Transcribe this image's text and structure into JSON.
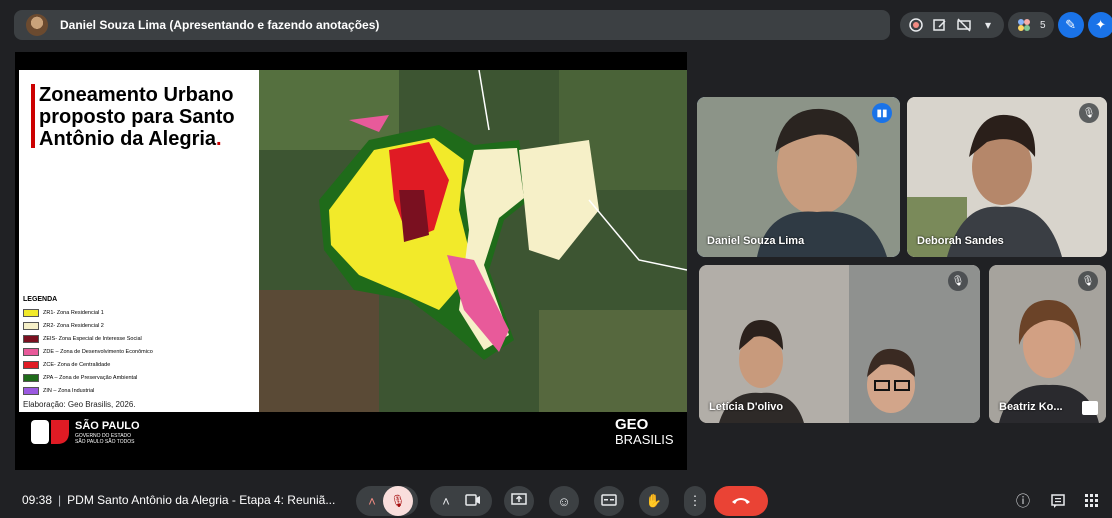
{
  "presenting": {
    "label": "Daniel Souza Lima (Apresentando e fazendo anotações)",
    "participant_count": "5"
  },
  "slide": {
    "title": "Zoneamento Urbano proposto para Santo Antônio da Alegria",
    "title_dot": ".",
    "legend_title": "LEGENDA",
    "legend": [
      {
        "label": "ZR1- Zona Residencial 1",
        "color": "#f2ea2a"
      },
      {
        "label": "ZR2- Zona Residencial 2",
        "color": "#f6f0c8"
      },
      {
        "label": "ZEIS- Zona Especial de Interesse Social",
        "color": "#7a1020"
      },
      {
        "label": "ZDE – Zona de Desenvolvimento Econômico",
        "color": "#e85a9a"
      },
      {
        "label": "ZCE- Zona de Centralidade",
        "color": "#e01b24"
      },
      {
        "label": "ZPA – Zona de Preservação Ambiental",
        "color": "#1f6b1a"
      },
      {
        "label": "ZIN – Zona Industrial",
        "color": "#9b59e0"
      }
    ],
    "credit": "Elaboração: Geo Brasilis, 2026.",
    "footer": {
      "sp_name": "SÃO PAULO",
      "sp_sub1": "GOVERNO DO ESTADO",
      "sp_sub2": "SÃO PAULO SÃO TODOS",
      "geo_name": "GEO",
      "geo_sub": "BRASILIS"
    }
  },
  "participants": [
    {
      "name": "Daniel Souza Lima",
      "state": "speaking"
    },
    {
      "name": "Deborah Sandes",
      "state": "muted"
    },
    {
      "name": "Letícia D'olivo",
      "state": "muted"
    },
    {
      "name": "",
      "state": "muted"
    },
    {
      "name": "Beatriz Ko...",
      "state": "muted"
    }
  ],
  "bottom": {
    "time": "09:38",
    "meeting_title": "PDM Santo Antônio da Alegria - Etapa 4: Reuniã..."
  },
  "colors": {
    "background": "#202124",
    "bar": "#3c4043",
    "end_call": "#ea4335",
    "accent_blue": "#1a73e8",
    "mic_off": "#5c2b29"
  },
  "icons": [
    "record-icon",
    "annotate-icon",
    "stop-presenting-icon",
    "people-icon",
    "edit-icon",
    "gemini-icon",
    "mic-off-icon",
    "camera-icon",
    "present-icon",
    "emoji-icon",
    "captions-icon",
    "raise-hand-icon",
    "more-icon",
    "end-call-icon",
    "info-icon",
    "chat-icon",
    "activities-icon"
  ]
}
